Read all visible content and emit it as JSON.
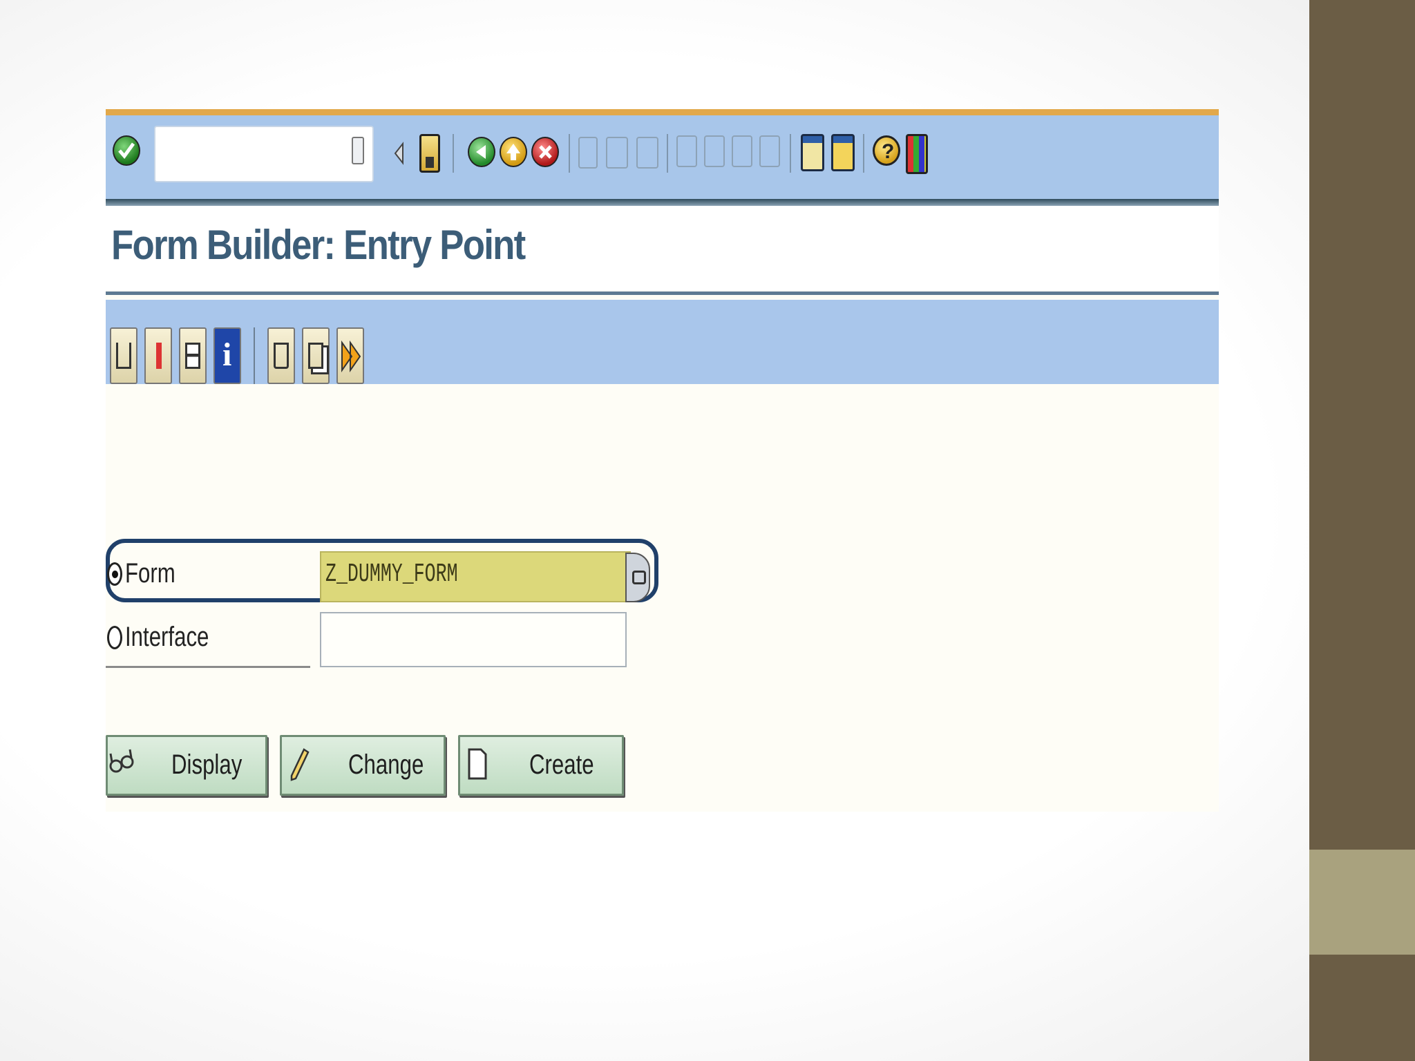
{
  "toolbar": {
    "command_field_value": "",
    "icons": [
      "enter-icon",
      "save-icon",
      "back-icon",
      "exit-icon",
      "cancel-icon",
      "print-icon",
      "find-icon",
      "find-next-icon",
      "first-page-icon",
      "previous-page-icon",
      "next-page-icon",
      "last-page-icon",
      "create-session-icon",
      "shortcut-icon",
      "help-icon",
      "customize-layout-icon"
    ]
  },
  "title": "Form Builder: Entry Point",
  "app_toolbar": {
    "icons": [
      "hierarchy-icon",
      "pin-icon",
      "test-icon",
      "info-icon",
      "delete-icon",
      "copy-icon",
      "transport-icon"
    ]
  },
  "form": {
    "form_label": "Form",
    "form_value": "Z_DUMMY_FORM",
    "form_selected": true,
    "interface_label": "Interface",
    "interface_value": "",
    "interface_selected": false
  },
  "buttons": {
    "display": "Display",
    "change": "Change",
    "create": "Create"
  },
  "colors": {
    "toolbar_blue": "#a8c6ea",
    "accent_orange": "#e2a84a",
    "title_blue": "#3c5d78",
    "input_yellow": "#dcd87a",
    "button_green": "#c6e0c9",
    "sidebar_brown": "#6b5d45",
    "sidebar_accent": "#a9a27e"
  }
}
